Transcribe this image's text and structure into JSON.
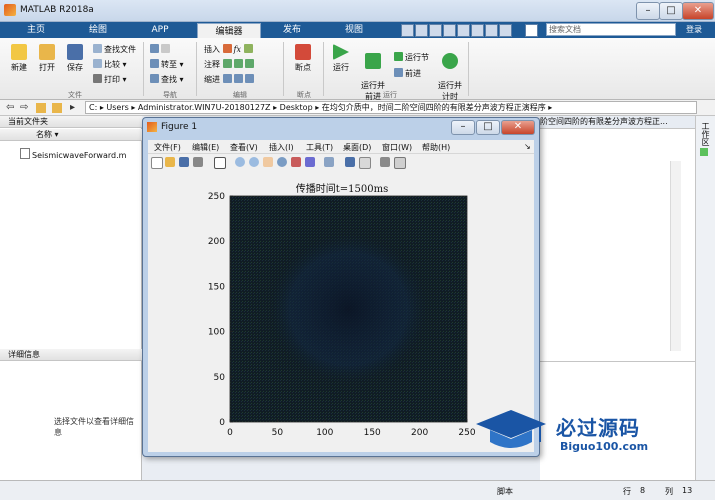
{
  "window": {
    "title": "MATLAB R2018a"
  },
  "ribbon_tabs": [
    {
      "label": "主页"
    },
    {
      "label": "绘图"
    },
    {
      "label": "APP"
    },
    {
      "label": "编辑器"
    },
    {
      "label": "发布"
    },
    {
      "label": "视图"
    }
  ],
  "search": {
    "placeholder": "搜索文档"
  },
  "login": {
    "label": "登录"
  },
  "ribbon": {
    "file": {
      "new": "新建",
      "open": "打开",
      "save": "保存",
      "find_files": "查找文件",
      "compare": "比较",
      "print": "打印",
      "group": "文件"
    },
    "navigate": {
      "goto": "转至",
      "find": "查找",
      "group": "导航"
    },
    "edit": {
      "insert": "插入",
      "comment": "注释",
      "indent": "缩进",
      "fx": "fx",
      "group": "编辑"
    },
    "breakpoints": {
      "label": "断点",
      "group": "断点"
    },
    "run": {
      "run": "运行",
      "run_advance": "运行并\n前进",
      "run_section": "运行节",
      "advance": "前进",
      "run_time": "运行并\n计时",
      "group": "运行"
    }
  },
  "address": {
    "segments": [
      "C:",
      "Users",
      "Administrator.WIN7U-20180127Z",
      "Desktop",
      "在均匀介质中，时间二阶空间四阶的有限差分声波方程正演程序"
    ]
  },
  "left_panel": {
    "header": "当前文件夹",
    "column": "名称",
    "files": [
      {
        "name": "SeismicwaveForward.m"
      }
    ],
    "details_header": "详细信息",
    "details_hint": "选择文件以查看详细信息"
  },
  "right_panel": {
    "tab_text": "阶空间四阶的有限差分声波方程正...",
    "workspace_label": "工作区"
  },
  "figure": {
    "title": "Figure 1",
    "menu": [
      "文件(F)",
      "编辑(E)",
      "查看(V)",
      "插入(I)",
      "工具(T)",
      "桌面(D)",
      "窗口(W)",
      "帮助(H)"
    ],
    "plot_title": "传播时间t=1500ms",
    "chart_data": {
      "type": "heatmap",
      "title": "传播时间t=1500ms",
      "xlim": [
        0,
        250
      ],
      "ylim": [
        0,
        250
      ],
      "xticks": [
        "0",
        "50",
        "100",
        "150",
        "200",
        "250"
      ],
      "yticks": [
        "0",
        "50",
        "100",
        "150",
        "200",
        "250"
      ],
      "colors": {
        "background": "#0e1a22"
      }
    }
  },
  "status": {
    "script": "脚本",
    "row_label": "行",
    "row": "8",
    "col_label": "列",
    "col": "13"
  },
  "watermark": {
    "text": "必过源码",
    "url": "Biguo100.com"
  }
}
